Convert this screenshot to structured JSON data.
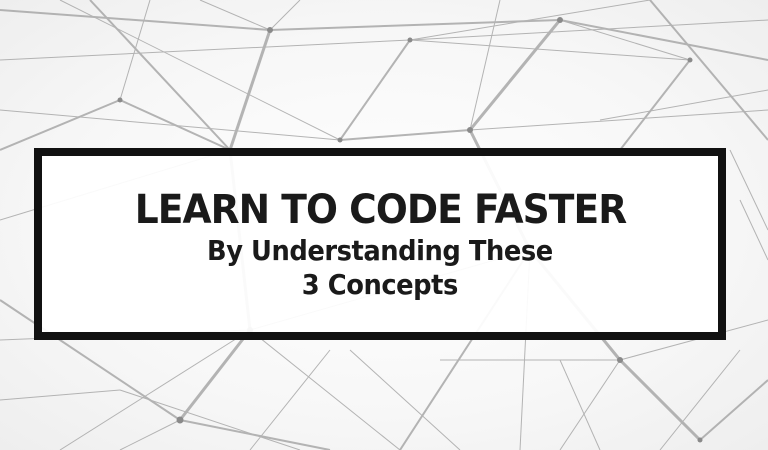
{
  "banner": {
    "headline": "LEARN TO CODE FASTER",
    "subline_1": "By Understanding These",
    "subline_2": "3 Concepts"
  },
  "background": {
    "description_icon": "network-lines-graphic",
    "line_color": "#9a9a9a",
    "node_color": "#7a7a7a"
  },
  "colors": {
    "frame": "#111111",
    "text": "#1a1a1a",
    "panel": "#ffffff"
  }
}
